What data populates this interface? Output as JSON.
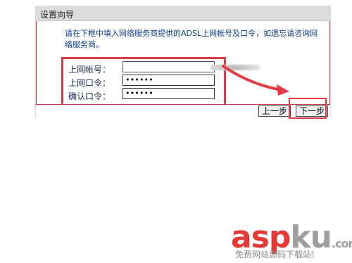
{
  "dialog": {
    "title": "设置向导",
    "instructions": "请在下框中填入网络服务商提供的ADSL上网帐号及口令，如遗忘请咨询网络服务商。"
  },
  "form": {
    "account_label": "上网帐号：",
    "account_value": "",
    "password_label": "上网口令：",
    "password_value": "••••••",
    "confirm_label": "确认口令：",
    "confirm_value": "••••••"
  },
  "buttons": {
    "prev_label": "上一步",
    "next_label": "下一步"
  },
  "watermark": {
    "brand_part1": "asp",
    "brand_part2": "ku",
    "brand_suffix": ".com",
    "subtitle": "免费网站源码下载站!"
  },
  "colors": {
    "highlight": "#e23b45",
    "instruction_text": "#0b3c8c"
  }
}
